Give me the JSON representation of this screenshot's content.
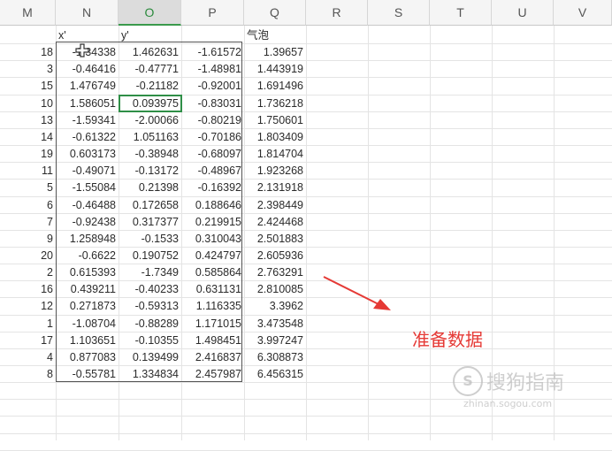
{
  "columns": [
    "M",
    "N",
    "O",
    "P",
    "Q",
    "R",
    "S",
    "T",
    "U",
    "V"
  ],
  "active_column": "O",
  "header_row": {
    "N": "x'",
    "O": "y'",
    "Q": "气泡"
  },
  "rows": [
    [
      "18",
      "-1.34338",
      "1.462631",
      "-1.61572",
      "1.39657"
    ],
    [
      "3",
      "-0.46416",
      "-0.47771",
      "-1.48981",
      "1.443919"
    ],
    [
      "15",
      "1.476749",
      "-0.21182",
      "-0.92001",
      "1.691496"
    ],
    [
      "10",
      "1.586051",
      "0.093975",
      "-0.83031",
      "1.736218"
    ],
    [
      "13",
      "-1.59341",
      "-2.00066",
      "-0.80219",
      "1.750601"
    ],
    [
      "14",
      "-0.61322",
      "1.051163",
      "-0.70186",
      "1.803409"
    ],
    [
      "19",
      "0.603173",
      "-0.38948",
      "-0.68097",
      "1.814704"
    ],
    [
      "11",
      "-0.49071",
      "-0.13172",
      "-0.48967",
      "1.923268"
    ],
    [
      "5",
      "-1.55084",
      "0.21398",
      "-0.16392",
      "2.131918"
    ],
    [
      "6",
      "-0.46488",
      "0.172658",
      "0.188646",
      "2.398449"
    ],
    [
      "7",
      "-0.92438",
      "0.317377",
      "0.219915",
      "2.424468"
    ],
    [
      "9",
      "1.258948",
      "-0.1533",
      "0.310043",
      "2.501883"
    ],
    [
      "20",
      "-0.6622",
      "0.190752",
      "0.424797",
      "2.605936"
    ],
    [
      "2",
      "0.615393",
      "-1.7349",
      "0.585864",
      "2.763291"
    ],
    [
      "16",
      "0.439211",
      "-0.40233",
      "0.631131",
      "2.810085"
    ],
    [
      "12",
      "0.271873",
      "-0.59313",
      "1.116335",
      "3.3962"
    ],
    [
      "1",
      "-1.08704",
      "-0.88289",
      "1.171015",
      "3.473548"
    ],
    [
      "17",
      "1.103651",
      "-0.10355",
      "1.498451",
      "3.997247"
    ],
    [
      "4",
      "0.877083",
      "0.139499",
      "2.416837",
      "6.308873"
    ],
    [
      "8",
      "-0.55781",
      "1.334834",
      "2.457987",
      "6.456315"
    ]
  ],
  "annotation": "准备数据",
  "watermark": {
    "logo": "S",
    "text": "搜狗指南",
    "url": "zhinan.sogou.com"
  },
  "colors": {
    "annotation": "#e53935",
    "selection": "#2f8f47",
    "header_bg": "#f5f5f5"
  }
}
